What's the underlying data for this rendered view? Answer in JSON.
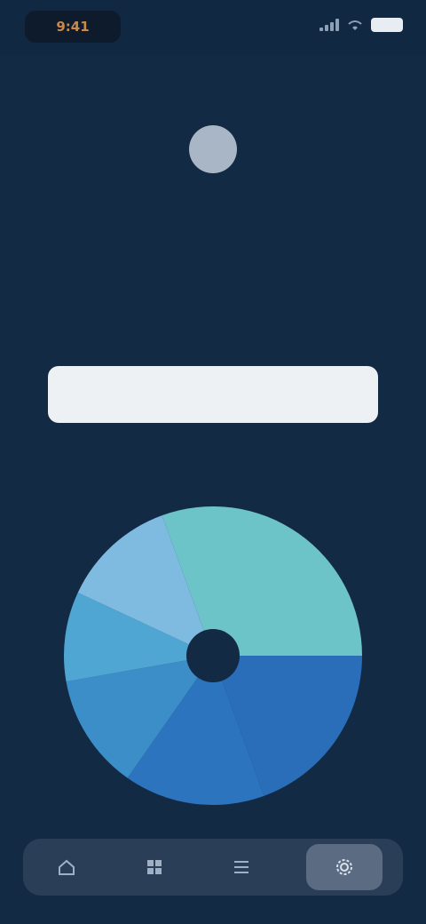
{
  "status_bar": {
    "time": "9:41"
  },
  "header": {
    "title": "",
    "subtitle": ""
  },
  "input": {
    "value": "",
    "placeholder": ""
  },
  "hint": {
    "label": ""
  },
  "wheel": {
    "segments": [
      {
        "name": "segment-1",
        "color": "#6cc4c9"
      },
      {
        "name": "segment-2",
        "color": "#2a6db8"
      },
      {
        "name": "segment-3",
        "color": "#2d74bf"
      },
      {
        "name": "segment-4",
        "color": "#3b8ec8"
      },
      {
        "name": "segment-5",
        "color": "#4fa6d3"
      },
      {
        "name": "segment-6",
        "color": "#7fbbe0"
      }
    ],
    "center_color": "#132a45"
  },
  "bottom_nav": {
    "items": [
      {
        "name": "nav-item-1",
        "icon": "home-icon"
      },
      {
        "name": "nav-item-2",
        "icon": "grid-icon"
      },
      {
        "name": "nav-item-3",
        "icon": "list-icon"
      },
      {
        "name": "nav-item-4",
        "icon": "settings-icon"
      }
    ],
    "active_index": 3
  },
  "colors": {
    "background": "#132a45",
    "accent_time": "#c98a4a",
    "input_bg": "#eef1f4",
    "nav_bg": "#2b3e58",
    "nav_active": "#5b6b82"
  }
}
